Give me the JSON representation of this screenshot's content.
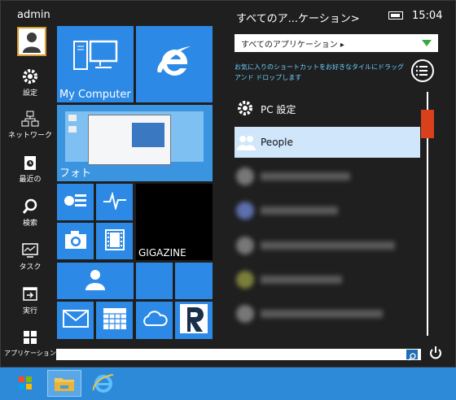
{
  "user": {
    "name": "admin"
  },
  "sidebar": {
    "items": [
      {
        "label": "設定",
        "icon": "gear-icon"
      },
      {
        "label": "ネットワーク",
        "icon": "network-icon"
      },
      {
        "label": "最近の",
        "icon": "recent-icon"
      },
      {
        "label": "検索",
        "icon": "search-icon"
      },
      {
        "label": "タスク",
        "icon": "task-icon"
      },
      {
        "label": "実行",
        "icon": "run-icon"
      },
      {
        "label": "アプリケーション",
        "icon": "apps-grid-icon"
      }
    ]
  },
  "tiles": {
    "my_computer": "My Computer",
    "photo": "フォト",
    "gigazine": "GIGAZINE"
  },
  "header": {
    "title": "すべてのア...ケーション>",
    "clock": "15:04"
  },
  "dropdown": {
    "value": "すべてのアプリケーション ▸"
  },
  "hint": "お気に入りのショートカットをお好きなタイルにドラッグ アンド ドロップします",
  "apps": [
    {
      "label": "PC 設定"
    },
    {
      "label": "People"
    }
  ],
  "search": {
    "placeholder": ""
  },
  "colors": {
    "tile_blue": "#2c8ae6",
    "accent_orange": "#d8411c",
    "selected_row": "#cfe6fb"
  }
}
